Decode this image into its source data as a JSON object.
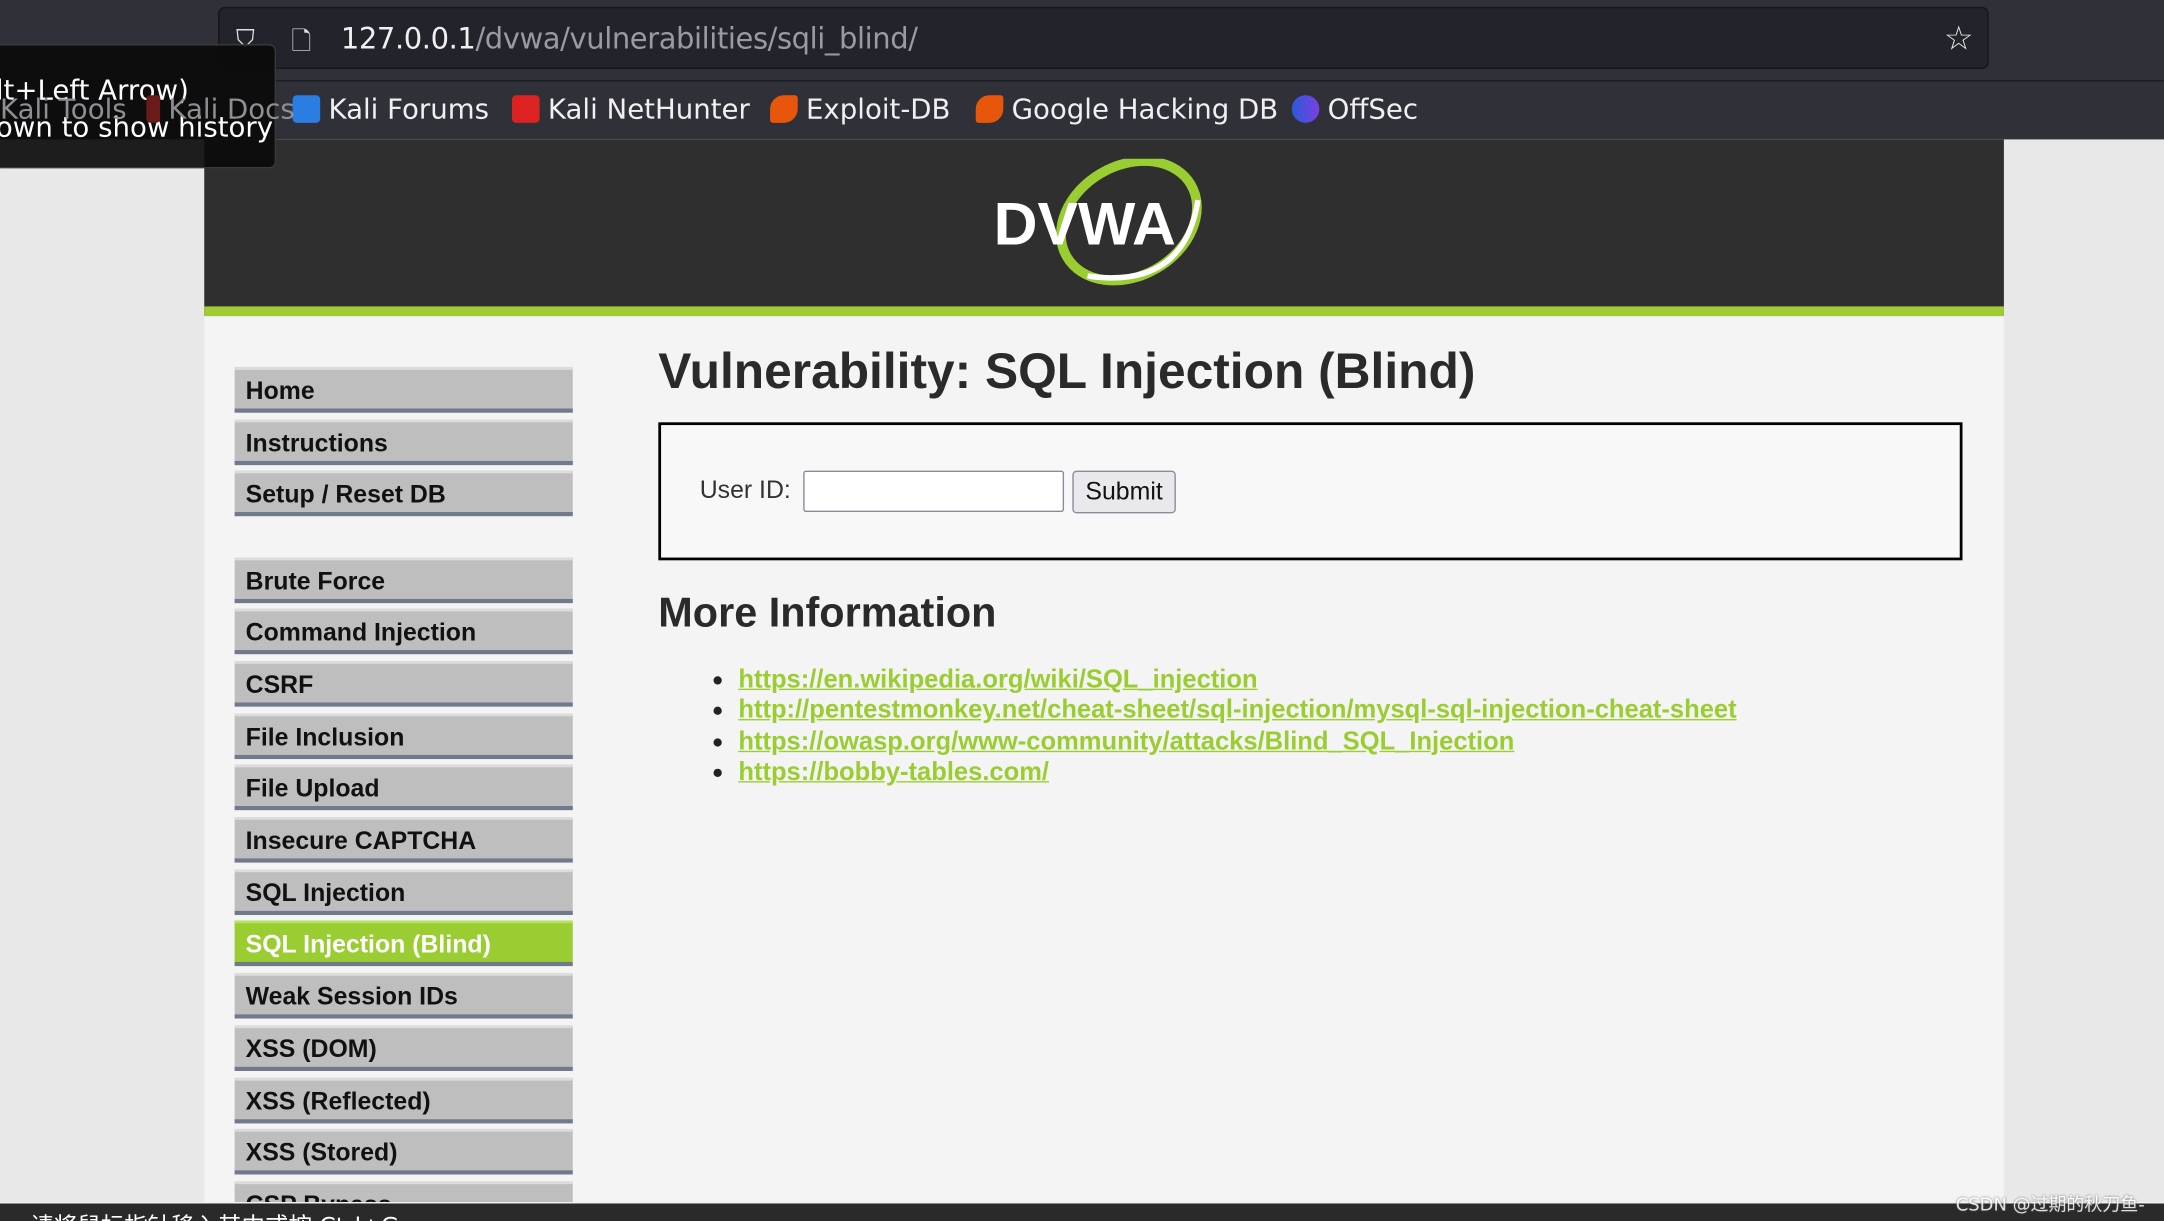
{
  "browser": {
    "url_host": "127.0.0.1",
    "url_path": "/dvwa/vulnerabilities/sqli_blind/",
    "bookmarks": [
      {
        "label": "Kali Tools",
        "icon": "kali-tools-icon"
      },
      {
        "label": "Kali Docs",
        "icon": "kali-docs-icon"
      },
      {
        "label": "Kali Forums",
        "icon": "kali-forums-icon"
      },
      {
        "label": "Kali NetHunter",
        "icon": "kali-nethunter-icon"
      },
      {
        "label": "Exploit-DB",
        "icon": "exploit-db-icon"
      },
      {
        "label": "Google Hacking DB",
        "icon": "exploit-db-icon"
      },
      {
        "label": "OffSec",
        "icon": "offsec-icon"
      }
    ],
    "tooltip_line1": "lt+Left Arrow)",
    "tooltip_line2": "own to show history",
    "status_text": "请将鼠标指针移入其中或按 Ctrl+G"
  },
  "logo_text": "DVWA",
  "menu": {
    "group1": [
      "Home",
      "Instructions",
      "Setup / Reset DB"
    ],
    "group2": [
      "Brute Force",
      "Command Injection",
      "CSRF",
      "File Inclusion",
      "File Upload",
      "Insecure CAPTCHA",
      "SQL Injection",
      "SQL Injection (Blind)",
      "Weak Session IDs",
      "XSS (DOM)",
      "XSS (Reflected)",
      "XSS (Stored)",
      "CSP Bypass"
    ],
    "selected": "SQL Injection (Blind)"
  },
  "main": {
    "title": "Vulnerability: SQL Injection (Blind)",
    "form": {
      "label": "User ID:",
      "value": "",
      "submit": "Submit"
    },
    "more_info_title": "More Information",
    "links": [
      "https://en.wikipedia.org/wiki/SQL_injection",
      "http://pentestmonkey.net/cheat-sheet/sql-injection/mysql-sql-injection-cheat-sheet",
      "https://owasp.org/www-community/attacks/Blind_SQL_Injection",
      "https://bobby-tables.com/"
    ]
  },
  "watermark": "CSDN @过期的秋刀鱼-",
  "colors": {
    "accent": "#9acd32",
    "header": "#2f2f2f",
    "browser": "#2f3038"
  }
}
